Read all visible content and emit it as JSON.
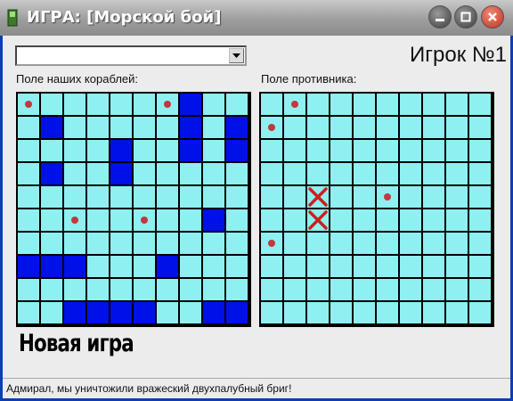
{
  "window": {
    "title": "ИГРА: [Морской бой]",
    "buttons": [
      "minimize",
      "maximize",
      "close"
    ]
  },
  "toolbar": {
    "combo_value": "",
    "player_label": "Игрок №1"
  },
  "own_field": {
    "label": "Поле наших кораблей:",
    "size": 10,
    "ship_cells": [
      [
        0,
        7
      ],
      [
        1,
        1
      ],
      [
        1,
        7
      ],
      [
        1,
        9
      ],
      [
        2,
        4
      ],
      [
        2,
        7
      ],
      [
        2,
        9
      ],
      [
        3,
        1
      ],
      [
        3,
        4
      ],
      [
        5,
        8
      ],
      [
        7,
        0
      ],
      [
        7,
        1
      ],
      [
        7,
        2
      ],
      [
        7,
        6
      ],
      [
        9,
        2
      ],
      [
        9,
        3
      ],
      [
        9,
        4
      ],
      [
        9,
        5
      ],
      [
        9,
        8
      ],
      [
        9,
        9
      ]
    ],
    "miss_cells": [
      [
        0,
        0
      ],
      [
        0,
        6
      ],
      [
        5,
        2
      ],
      [
        5,
        5
      ]
    ],
    "hit_cells": []
  },
  "enemy_field": {
    "label": "Поле противника:",
    "size": 10,
    "ship_cells": [],
    "miss_cells": [
      [
        0,
        1
      ],
      [
        1,
        0
      ],
      [
        4,
        5
      ],
      [
        6,
        0
      ]
    ],
    "hit_cells": [
      [
        4,
        2
      ],
      [
        5,
        2
      ]
    ]
  },
  "colors": {
    "water": "#8ff0f2",
    "ship": "#0010e8",
    "grid": "#000000",
    "miss": "#c0393b",
    "hit": "#cc1f1f"
  },
  "new_game_label": "Новая игра",
  "status": {
    "text": "Адмирал, мы уничтожили вражеский двухпалубный бриг!"
  }
}
